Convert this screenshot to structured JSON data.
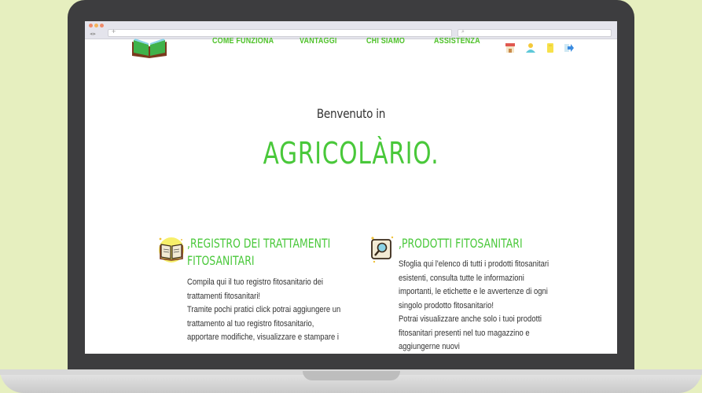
{
  "browser": {
    "url": "",
    "search": ""
  },
  "nav": {
    "items": [
      "Come funziona",
      "Vantaggi",
      "Chi siamo",
      "Assistenza"
    ],
    "icons": [
      "shop-icon",
      "user-icon",
      "document-icon",
      "logout-icon"
    ]
  },
  "hero": {
    "welcome": "Benvenuto in",
    "brand": "Agricolàrio."
  },
  "features": [
    {
      "icon": "book-icon",
      "title_lines": [
        ",Registro dei trattamenti",
        "fitosanitari"
      ],
      "body_lines": [
        "Compila qui il tuo registro fitosanitario dei",
        "trattamenti fitosanitari!",
        "Tramite pochi pratici click potrai aggiungere un",
        "trattamento al tuo registro fitosanitario,",
        "apportare modifiche, visualizzare e stampare i"
      ]
    },
    {
      "icon": "magnifier-icon",
      "title_lines": [
        ",Prodotti fitosanitari"
      ],
      "body_lines": [
        "Sfoglia qui l'elenco di tutti i prodotti fitosanitari",
        "esistenti, consulta tutte le informazioni",
        "importanti, le etichette e le avvertenze di ogni",
        "singolo prodotto fitosanitario!",
        "Potrai visualizzare anche solo i tuoi prodotti",
        "fitosanitari presenti nel tuo magazzino e",
        "aggiungerne nuovi"
      ]
    }
  ],
  "colors": {
    "accent_green": "#49c83a",
    "background": "#e6efbf",
    "laptop_frame": "#3d3d3f"
  }
}
